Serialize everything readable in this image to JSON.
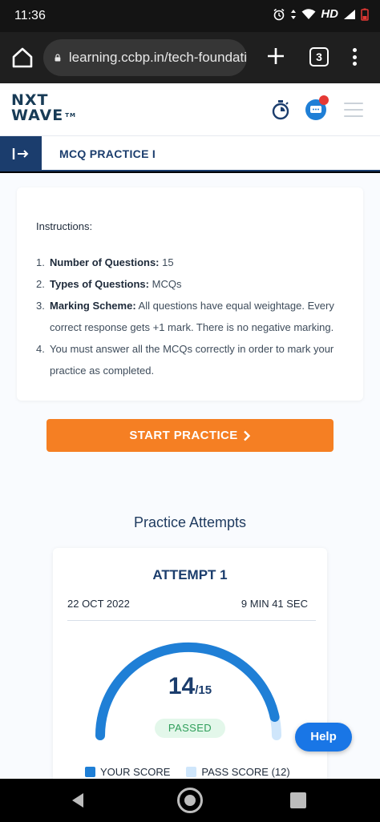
{
  "status_bar": {
    "time": "11:36",
    "network_label": "HD"
  },
  "browser": {
    "url": "learning.ccbp.in/tech-foundati",
    "tab_count": "3"
  },
  "app_header": {
    "logo_line1": "NXT",
    "logo_line2": "WAVE",
    "logo_tm": "TM"
  },
  "title_bar": {
    "title": "MCQ PRACTICE I"
  },
  "instructions": {
    "heading": "Instructions:",
    "items": [
      {
        "num": "1.",
        "label": "Number of Questions:",
        "text": " 15"
      },
      {
        "num": "2.",
        "label": "Types of Questions:",
        "text": " MCQs"
      },
      {
        "num": "3.",
        "label": "Marking Scheme:",
        "text": "  All questions have equal weightage. Every correct response gets +1 mark. There is no negative marking."
      },
      {
        "num": "4.",
        "label": "",
        "text": "You must answer all the MCQs correctly in order to mark your practice as completed."
      }
    ]
  },
  "start_button": {
    "label": "START PRACTICE",
    "icon": "chevron-right-icon"
  },
  "attempts": {
    "heading": "Practice Attempts",
    "card": {
      "title": "ATTEMPT 1",
      "date": "22 OCT 2022",
      "duration": "9 MIN 41 SEC",
      "score": "14",
      "score_total": "/15",
      "score_fraction": 0.933,
      "status": "PASSED"
    },
    "legend": {
      "your_score": "YOUR SCORE",
      "pass_score": "PASS SCORE (12)"
    }
  },
  "help_button": {
    "label": "Help"
  },
  "colors": {
    "brand_navy": "#1b3d6d",
    "primary_orange": "#f57f23",
    "score_blue": "#1f7fd6",
    "pass_light_blue": "#cfe6fb",
    "passed_green": "#2f9e5a",
    "help_blue": "#1976e6",
    "notification_red": "#e53935"
  }
}
